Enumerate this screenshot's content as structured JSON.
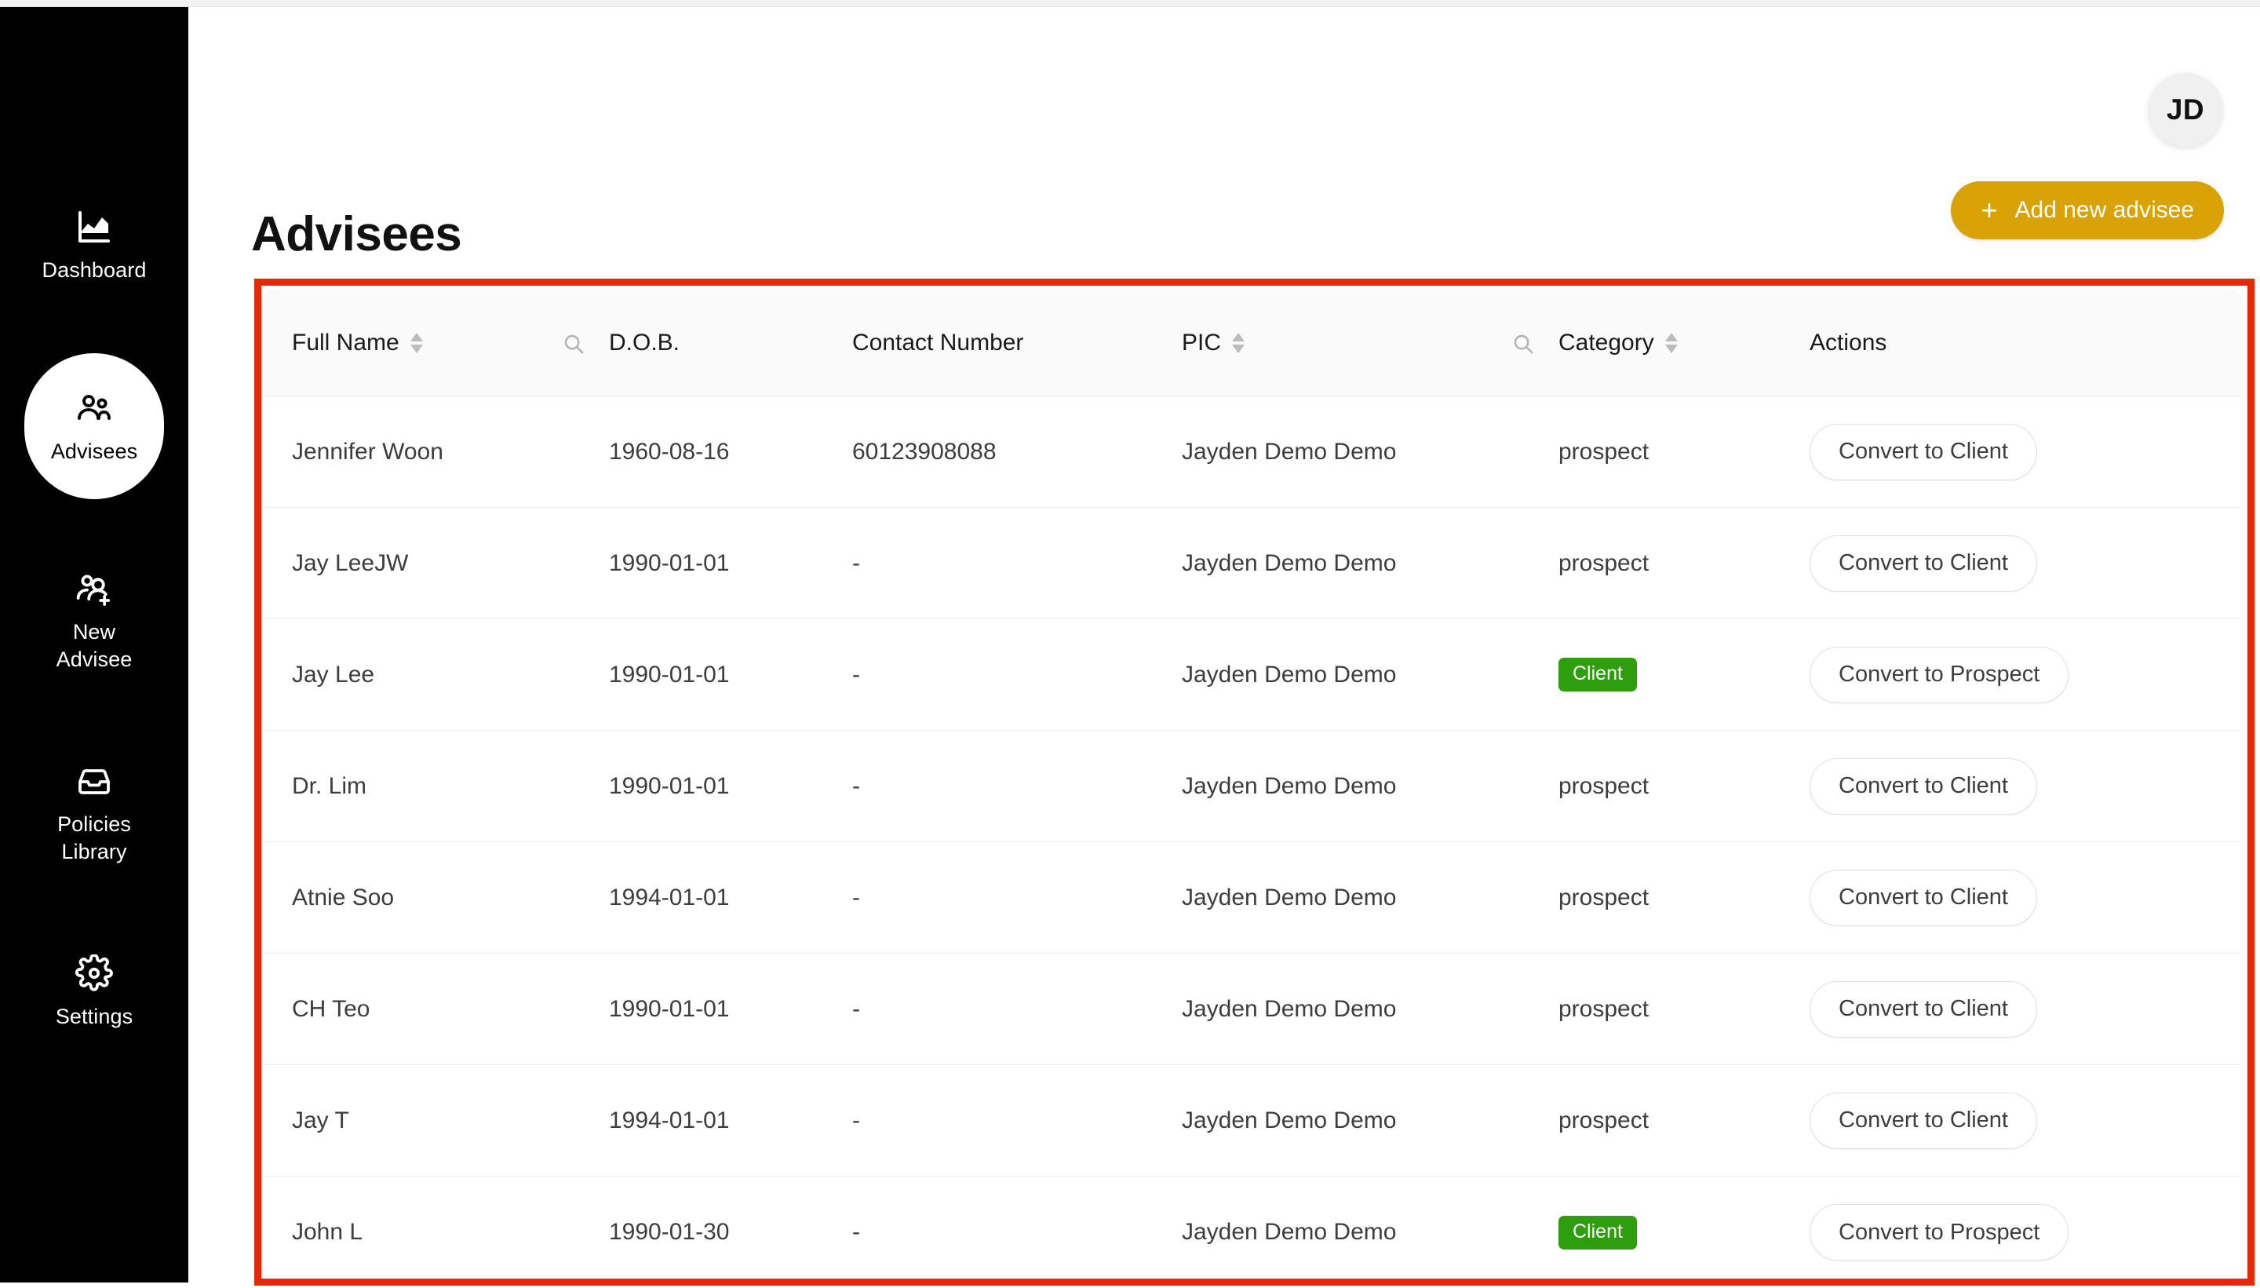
{
  "sidebar": {
    "items": [
      {
        "label": "Dashboard",
        "icon": "chart-icon",
        "active": false
      },
      {
        "label": "Advisees",
        "icon": "users-icon",
        "active": true
      },
      {
        "label": "New\nAdvisee",
        "icon": "user-plus-icon",
        "active": false
      },
      {
        "label": "Policies\nLibrary",
        "icon": "inbox-icon",
        "active": false
      },
      {
        "label": "Settings",
        "icon": "gear-icon",
        "active": false
      }
    ]
  },
  "header": {
    "title": "Advisees",
    "avatar_initials": "JD",
    "add_button_label": "Add new advisee",
    "add_button_plus": "+",
    "accent_color": "#d9a207"
  },
  "table": {
    "columns": [
      {
        "label": "Full Name",
        "sortable": true,
        "searchable": false
      },
      {
        "label": "D.O.B.",
        "sortable": false,
        "searchable": true
      },
      {
        "label": "Contact Number",
        "sortable": false,
        "searchable": false
      },
      {
        "label": "PIC",
        "sortable": true,
        "searchable": false
      },
      {
        "label": "Category",
        "sortable": true,
        "searchable": true
      },
      {
        "label": "Actions",
        "sortable": false,
        "searchable": false
      }
    ],
    "rows": [
      {
        "full_name": "Jennifer Woon",
        "dob": "1960-08-16",
        "contact": "60123908088",
        "pic": "Jayden Demo Demo",
        "category": "prospect",
        "category_badge": false,
        "action": "Convert to Client"
      },
      {
        "full_name": "Jay LeeJW",
        "dob": "1990-01-01",
        "contact": "-",
        "pic": "Jayden Demo Demo",
        "category": "prospect",
        "category_badge": false,
        "action": "Convert to Client"
      },
      {
        "full_name": "Jay Lee",
        "dob": "1990-01-01",
        "contact": "-",
        "pic": "Jayden Demo Demo",
        "category": "Client",
        "category_badge": true,
        "action": "Convert to Prospect"
      },
      {
        "full_name": "Dr. Lim",
        "dob": "1990-01-01",
        "contact": "-",
        "pic": "Jayden Demo Demo",
        "category": "prospect",
        "category_badge": false,
        "action": "Convert to Client"
      },
      {
        "full_name": "Atnie Soo",
        "dob": "1994-01-01",
        "contact": "-",
        "pic": "Jayden Demo Demo",
        "category": "prospect",
        "category_badge": false,
        "action": "Convert to Client"
      },
      {
        "full_name": "CH Teo",
        "dob": "1990-01-01",
        "contact": "-",
        "pic": "Jayden Demo Demo",
        "category": "prospect",
        "category_badge": false,
        "action": "Convert to Client"
      },
      {
        "full_name": "Jay T",
        "dob": "1994-01-01",
        "contact": "-",
        "pic": "Jayden Demo Demo",
        "category": "prospect",
        "category_badge": false,
        "action": "Convert to Client"
      },
      {
        "full_name": "John L",
        "dob": "1990-01-30",
        "contact": "-",
        "pic": "Jayden Demo Demo",
        "category": "Client",
        "category_badge": true,
        "action": "Convert to Prospect"
      }
    ],
    "badge_color": "#2f9e0e"
  },
  "annotation": {
    "highlight_color": "#e32a08"
  }
}
